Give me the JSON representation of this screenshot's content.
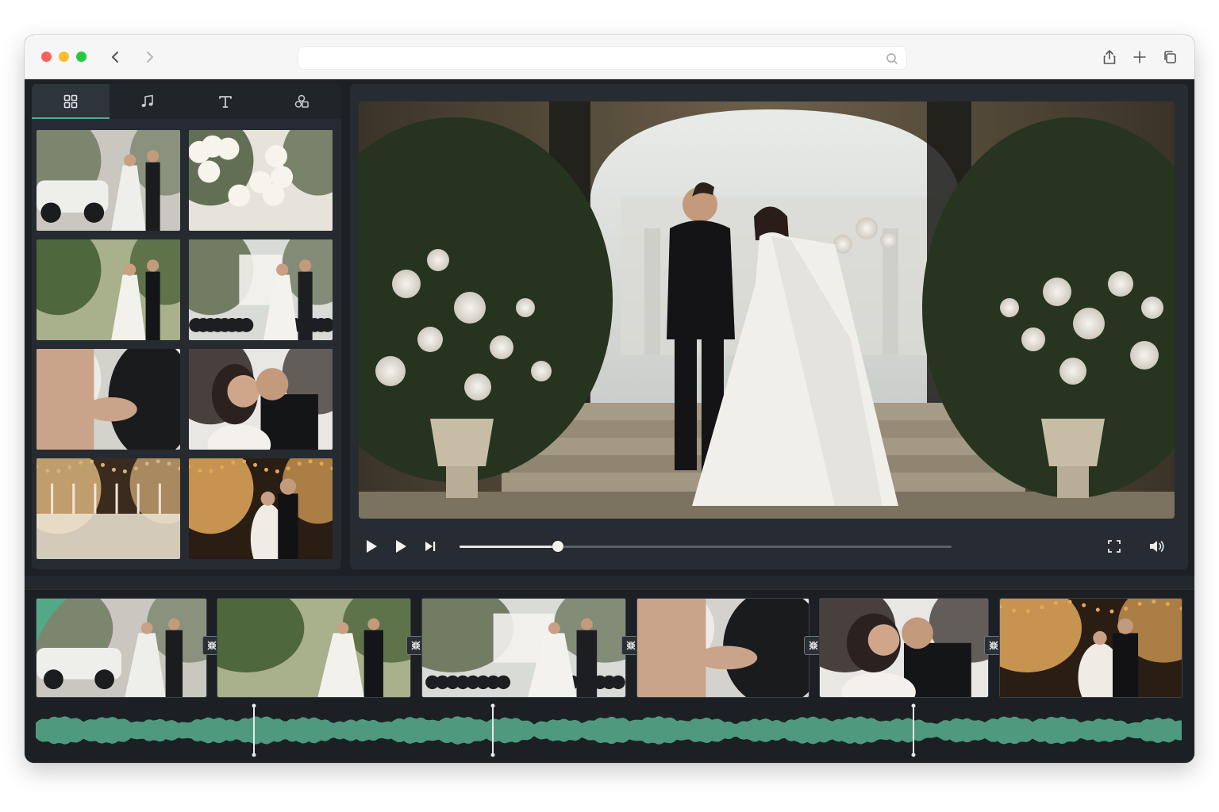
{
  "browser": {
    "url": "",
    "icons": [
      "back-icon",
      "forward-icon",
      "search-icon",
      "share-icon",
      "new-tab-icon",
      "tabs-icon"
    ]
  },
  "media_panel": {
    "tabs": [
      {
        "name": "media",
        "icon": "grid-icon",
        "active": true
      },
      {
        "name": "audio",
        "icon": "music-note-icon",
        "active": false
      },
      {
        "name": "text",
        "icon": "text-icon",
        "active": false
      },
      {
        "name": "effects",
        "icon": "shapes-icon",
        "active": false
      }
    ],
    "thumbnails": [
      {
        "scene": "vintage-car",
        "palette": [
          "#c9c7bf",
          "#6f7a5f",
          "#eeeeea",
          "#1b1c1e"
        ]
      },
      {
        "scene": "bouquet",
        "palette": [
          "#e6e3da",
          "#4a5a3c",
          "#f7f4ec",
          "#cfc9bb"
        ]
      },
      {
        "scene": "garden-walk",
        "palette": [
          "#a8b08c",
          "#3f5a2e",
          "#f3f1ec",
          "#141518"
        ]
      },
      {
        "scene": "ceremony-aisle",
        "palette": [
          "#d8dbd6",
          "#5f6b4e",
          "#f4f2ee",
          "#1d1e22"
        ]
      },
      {
        "scene": "holding-hands",
        "palette": [
          "#d4d2cc",
          "#f2efe9",
          "#1a1b1d",
          "#c9a48a"
        ]
      },
      {
        "scene": "embrace",
        "palette": [
          "#e8e7e4",
          "#2b2220",
          "#f4f1ec",
          "#141517"
        ]
      },
      {
        "scene": "reception-table",
        "palette": [
          "#3a2b1e",
          "#d8b27a",
          "#efe6d6",
          "#8a7658"
        ]
      },
      {
        "scene": "first-dance",
        "palette": [
          "#2a1d14",
          "#e2a85a",
          "#f0ebe3",
          "#121215"
        ]
      }
    ]
  },
  "player": {
    "progress": 0.2,
    "icons": [
      "play-icon",
      "play-alt-icon",
      "skip-forward-icon",
      "fullscreen-icon",
      "volume-icon"
    ]
  },
  "timeline": {
    "clips": [
      {
        "scene": "vintage-car",
        "palette": [
          "#c9c7bf",
          "#6f7a5f",
          "#eeeeea",
          "#1b1c1e"
        ],
        "accent": "#4caf8c"
      },
      {
        "scene": "garden-walk",
        "palette": [
          "#a8b08c",
          "#3f5a2e",
          "#f3f1ec",
          "#141518"
        ]
      },
      {
        "scene": "ceremony-aisle",
        "palette": [
          "#d8dbd6",
          "#5f6b4e",
          "#f4f2ee",
          "#1d1e22"
        ]
      },
      {
        "scene": "holding-hands",
        "palette": [
          "#d4d2cc",
          "#f2efe9",
          "#1a1b1d",
          "#c9a48a"
        ]
      },
      {
        "scene": "embrace",
        "palette": [
          "#e8e7e4",
          "#2b2220",
          "#f4f1ec",
          "#141517"
        ]
      },
      {
        "scene": "first-dance",
        "palette": [
          "#2a1d14",
          "#e2a85a",
          "#f0ebe3",
          "#121215"
        ]
      }
    ],
    "transition_icon": "transition-icon",
    "audio": {
      "color": "#4f9a7e",
      "markers": 3
    }
  }
}
